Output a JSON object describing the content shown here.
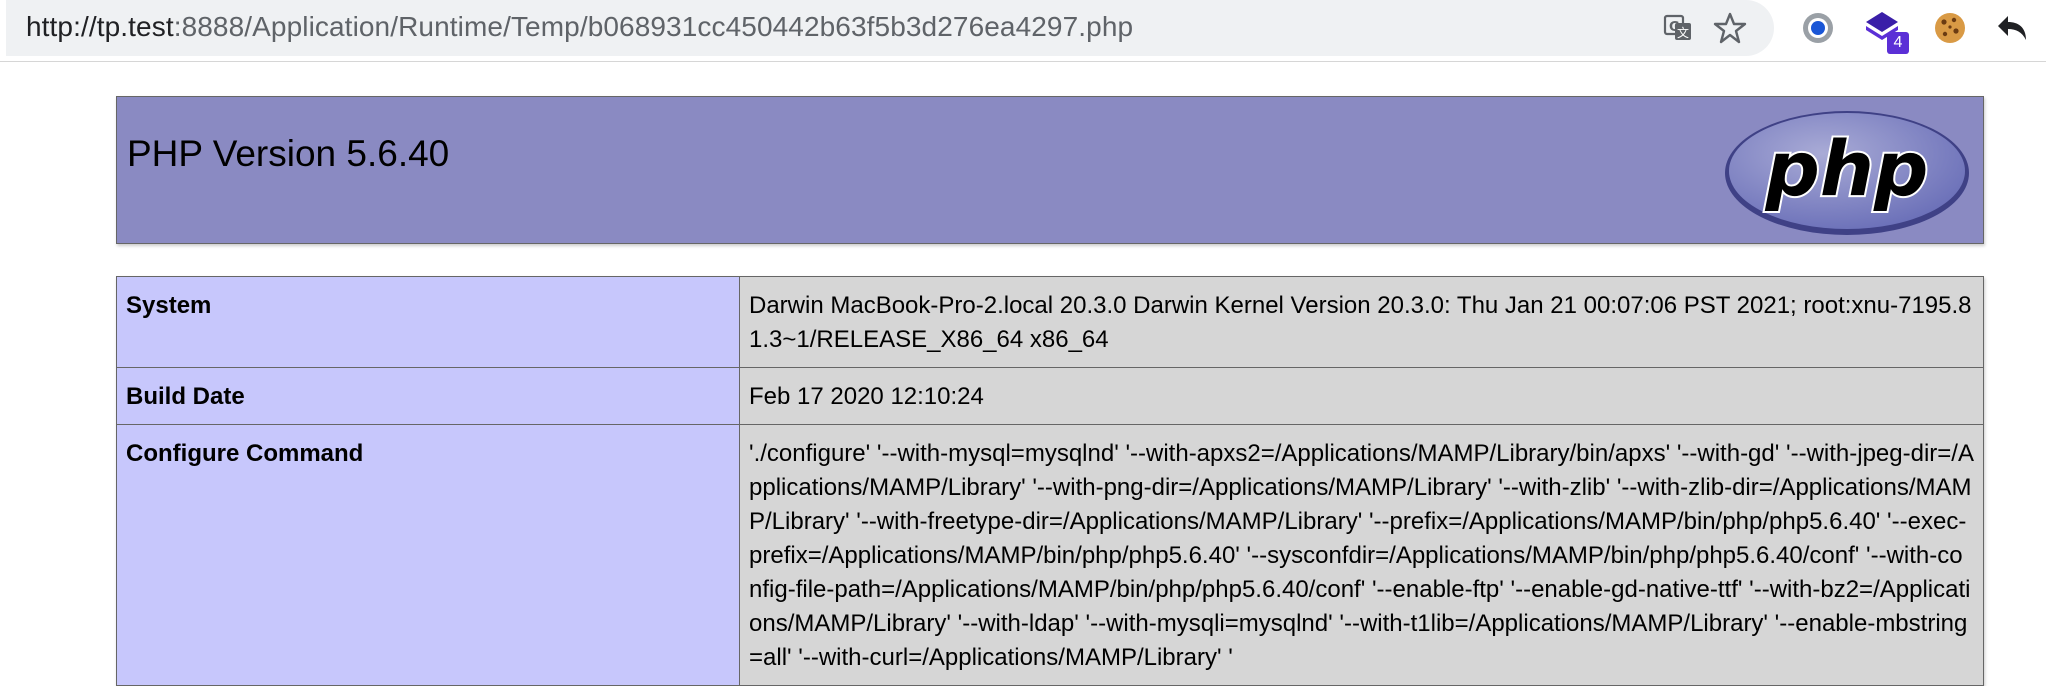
{
  "browser": {
    "url_host": "http://tp.test",
    "url_rest": ":8888/Application/Runtime/Temp/b068931cc450442b63f5b3d276ea4297.php",
    "extension_badge": "4",
    "icons": [
      "translate-icon",
      "star-icon",
      "extension-circle-icon",
      "extension-stack-icon",
      "cookie-icon",
      "back-arrow-icon"
    ]
  },
  "header": {
    "title": "PHP Version 5.6.40",
    "logo_text": "php",
    "color": "#8a8ac2"
  },
  "info_table": {
    "rows": [
      {
        "label": "System",
        "value": "Darwin MacBook-Pro-2.local 20.3.0 Darwin Kernel Version 20.3.0: Thu Jan 21 00:07:06 PST 2021; root:xnu-7195.81.3~1/RELEASE_X86_64 x86_64"
      },
      {
        "label": "Build Date",
        "value": "Feb 17 2020 12:10:24"
      },
      {
        "label": "Configure Command",
        "value": "'./configure' '--with-mysql=mysqlnd' '--with-apxs2=/Applications/MAMP/Library/bin/apxs' '--with-gd' '--with-jpeg-dir=/Applications/MAMP/Library' '--with-png-dir=/Applications/MAMP/Library' '--with-zlib' '--with-zlib-dir=/Applications/MAMP/Library' '--with-freetype-dir=/Applications/MAMP/Library' '--prefix=/Applications/MAMP/bin/php/php5.6.40' '--exec-prefix=/Applications/MAMP/bin/php/php5.6.40' '--sysconfdir=/Applications/MAMP/bin/php/php5.6.40/conf' '--with-config-file-path=/Applications/MAMP/bin/php/php5.6.40/conf' '--enable-ftp' '--enable-gd-native-ttf' '--with-bz2=/Applications/MAMP/Library' '--with-ldap' '--with-mysqli=mysqlnd' '--with-t1lib=/Applications/MAMP/Library' '--enable-mbstring=all' '--with-curl=/Applications/MAMP/Library' '"
      }
    ],
    "label_color": "#c7c7fc",
    "value_color": "#d6d6d6"
  }
}
